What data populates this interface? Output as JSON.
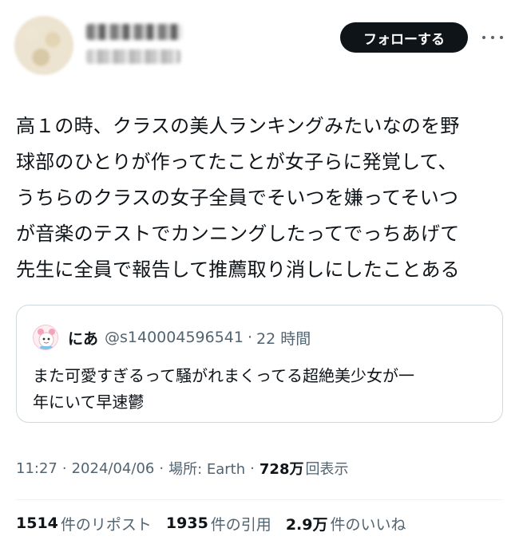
{
  "author": {
    "avatar_icon": "blurred-avatar",
    "name_blurred": true,
    "handle_blurred": true
  },
  "header": {
    "follow_label": "フォローする",
    "more_icon": "more-horizontal-icon"
  },
  "tweet": {
    "lines": [
      "高１の時、クラスの美人ランキングみたいなのを野",
      "球部のひとりが作ってたことが女子らに発覚して、",
      "うちらのクラスの女子全員でそいつを嫌ってそいつ",
      "が音楽のテストでカンニングしたってでっちあげて",
      "先生に全員で報告して推薦取り消しにしたことある"
    ]
  },
  "quote": {
    "avatar_icon": "quoted-user-avatar",
    "name": "にあ",
    "handle": "@s140004596541",
    "dot": "·",
    "time": "22 時間",
    "lines": [
      "また可愛すぎるって騒がれまくってる超絶美少女が一",
      "年にいて早速鬱"
    ]
  },
  "meta": {
    "time": "11:27",
    "sep": "·",
    "date": "2024/04/06",
    "location": "場所: Earth",
    "views_number": "728万",
    "views_label": "回表示"
  },
  "stats": {
    "reposts_number": "1514",
    "reposts_label": "件のリポスト",
    "quotes_number": "1935",
    "quotes_label": "件の引用",
    "likes_number": "2.9万",
    "likes_label": "件のいいね"
  },
  "colors": {
    "text": "#0f1419",
    "secondary": "#536471",
    "border": "#cfd9de",
    "button_bg": "#0f1419"
  }
}
